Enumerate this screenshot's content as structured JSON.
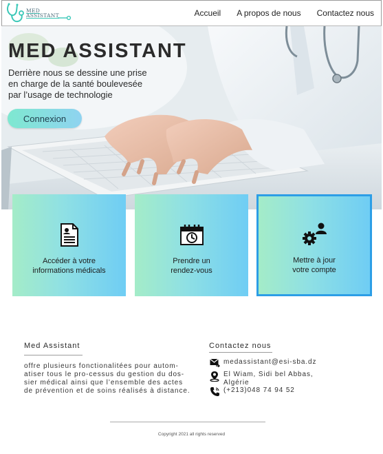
{
  "nav": {
    "logo_line1": "MED",
    "logo_line2": "ASSISTANT",
    "links": [
      "Accueil",
      "A propos de nous",
      "Contactez nous"
    ]
  },
  "hero": {
    "title": "MED ASSISTANT",
    "subtitle_lines": [
      "Derrière nous se dessine une prise",
      "en charge de la santé boulevesée",
      "par l’usage de technologie"
    ],
    "button_label": "Connexion"
  },
  "cards": [
    {
      "icon": "medical-record-icon",
      "lines": [
        "Accéder à votre",
        "informations médicals"
      ]
    },
    {
      "icon": "calendar-clock-icon",
      "lines": [
        "Prendre un",
        "rendez-vous"
      ]
    },
    {
      "icon": "user-settings-icon",
      "lines": [
        "Mettre à jour",
        "votre compte"
      ]
    }
  ],
  "footer": {
    "about_title": "Med Assistant",
    "about_lines": [
      "offre plusieurs fonctionalitées pour autom-",
      "atiser tous le pro-cessus du gestion du dos-",
      "sier médical ainsi que l’ensemble des actes",
      "de prévention et de soins réalisés à distance."
    ],
    "contact_title": "Contactez nous",
    "email": "medassistant@esi-sba.dz",
    "address_lines": [
      "El Wiam, Sidi bel Abbas,",
      " Algérie"
    ],
    "phone": "(+213)048 74 94 52",
    "copyright": "Copyright 2021 all rights reserved"
  },
  "colors": {
    "card_gradient_start": "#a4ecc8",
    "card_gradient_end": "#6fcdf4",
    "selected_border": "#2c9ee6",
    "button_gradient_start": "#7ee8d0",
    "button_gradient_end": "#8fd3f0"
  }
}
